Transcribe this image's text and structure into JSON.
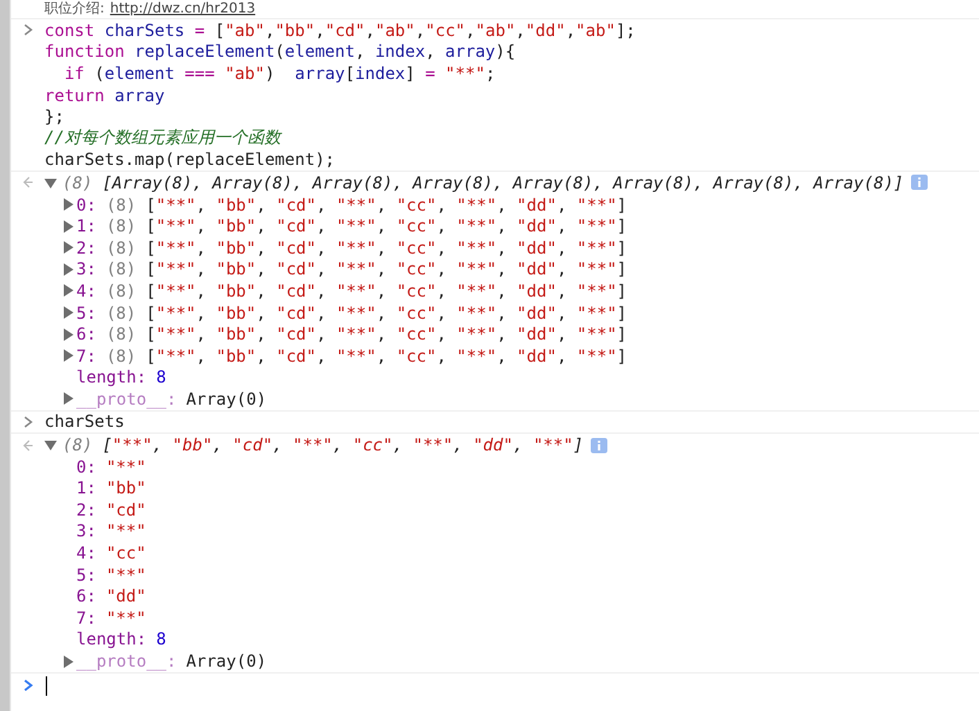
{
  "top_message": {
    "label": "职位介绍:",
    "link": "http://dwz.cn/hr2013"
  },
  "entries": [
    {
      "kind": "input",
      "lines": [
        [
          {
            "kind": "keyword",
            "s": "const"
          },
          {
            "kind": "variable",
            "s": " charSets"
          },
          {
            "kind": "operator",
            "s": " ="
          },
          {
            "kind": "plain",
            "s": " ["
          },
          {
            "kind": "string",
            "s": "\"ab\""
          },
          {
            "kind": "plain",
            "s": ","
          },
          {
            "kind": "string",
            "s": "\"bb\""
          },
          {
            "kind": "plain",
            "s": ","
          },
          {
            "kind": "string",
            "s": "\"cd\""
          },
          {
            "kind": "plain",
            "s": ","
          },
          {
            "kind": "string",
            "s": "\"ab\""
          },
          {
            "kind": "plain",
            "s": ","
          },
          {
            "kind": "string",
            "s": "\"cc\""
          },
          {
            "kind": "plain",
            "s": ","
          },
          {
            "kind": "string",
            "s": "\"ab\""
          },
          {
            "kind": "plain",
            "s": ","
          },
          {
            "kind": "string",
            "s": "\"dd\""
          },
          {
            "kind": "plain",
            "s": ","
          },
          {
            "kind": "string",
            "s": "\"ab\""
          },
          {
            "kind": "plain",
            "s": "];"
          }
        ],
        [
          {
            "kind": "keyword",
            "s": "function"
          },
          {
            "kind": "variable",
            "s": " replaceElement"
          },
          {
            "kind": "plain",
            "s": "("
          },
          {
            "kind": "variable",
            "s": "element"
          },
          {
            "kind": "plain",
            "s": ", "
          },
          {
            "kind": "variable",
            "s": "index"
          },
          {
            "kind": "plain",
            "s": ", "
          },
          {
            "kind": "variable",
            "s": "array"
          },
          {
            "kind": "plain",
            "s": "){"
          }
        ],
        [
          {
            "kind": "keyword",
            "s": "  if"
          },
          {
            "kind": "plain",
            "s": " ("
          },
          {
            "kind": "variable",
            "s": "element"
          },
          {
            "kind": "operator",
            "s": " === "
          },
          {
            "kind": "string",
            "s": "\"ab\""
          },
          {
            "kind": "plain",
            "s": ")  "
          },
          {
            "kind": "variable",
            "s": "array"
          },
          {
            "kind": "plain",
            "s": "["
          },
          {
            "kind": "variable",
            "s": "index"
          },
          {
            "kind": "plain",
            "s": "] "
          },
          {
            "kind": "operator",
            "s": "= "
          },
          {
            "kind": "string",
            "s": "\"**\""
          },
          {
            "kind": "plain",
            "s": ";"
          }
        ],
        [
          {
            "kind": "keyword",
            "s": "return"
          },
          {
            "kind": "variable",
            "s": " array"
          }
        ],
        [
          {
            "kind": "plain",
            "s": "};"
          }
        ],
        [
          {
            "kind": "comment",
            "s": "//对每个数组元素应用一个函数"
          }
        ],
        [
          {
            "kind": "plain",
            "s": "charSets.map(replaceElement);"
          }
        ]
      ]
    },
    {
      "kind": "output",
      "expanded": true,
      "count": "(8)",
      "preview": "[Array(8), Array(8), Array(8), Array(8), Array(8), Array(8), Array(8), Array(8)]",
      "children": [
        {
          "kind": "array",
          "key": "0:",
          "expanded": false,
          "count": "(8)",
          "preview": "[\"**\", \"bb\", \"cd\", \"**\", \"cc\", \"**\", \"dd\", \"**\"]"
        },
        {
          "kind": "array",
          "key": "1:",
          "expanded": false,
          "count": "(8)",
          "preview": "[\"**\", \"bb\", \"cd\", \"**\", \"cc\", \"**\", \"dd\", \"**\"]"
        },
        {
          "kind": "array",
          "key": "2:",
          "expanded": false,
          "count": "(8)",
          "preview": "[\"**\", \"bb\", \"cd\", \"**\", \"cc\", \"**\", \"dd\", \"**\"]"
        },
        {
          "kind": "array",
          "key": "3:",
          "expanded": false,
          "count": "(8)",
          "preview": "[\"**\", \"bb\", \"cd\", \"**\", \"cc\", \"**\", \"dd\", \"**\"]"
        },
        {
          "kind": "array",
          "key": "4:",
          "expanded": false,
          "count": "(8)",
          "preview": "[\"**\", \"bb\", \"cd\", \"**\", \"cc\", \"**\", \"dd\", \"**\"]"
        },
        {
          "kind": "array",
          "key": "5:",
          "expanded": false,
          "count": "(8)",
          "preview": "[\"**\", \"bb\", \"cd\", \"**\", \"cc\", \"**\", \"dd\", \"**\"]"
        },
        {
          "kind": "array",
          "key": "6:",
          "expanded": false,
          "count": "(8)",
          "preview": "[\"**\", \"bb\", \"cd\", \"**\", \"cc\", \"**\", \"dd\", \"**\"]"
        },
        {
          "kind": "array",
          "key": "7:",
          "expanded": false,
          "count": "(8)",
          "preview": "[\"**\", \"bb\", \"cd\", \"**\", \"cc\", \"**\", \"dd\", \"**\"]"
        },
        {
          "kind": "number",
          "key": "length:",
          "value": "8"
        },
        {
          "kind": "proto",
          "key": "__proto__:",
          "value": "Array(0)",
          "expanded": false
        }
      ]
    },
    {
      "kind": "input",
      "lines": [
        [
          {
            "kind": "plain",
            "s": "charSets"
          }
        ]
      ]
    },
    {
      "kind": "output",
      "expanded": true,
      "count": "(8)",
      "preview": "[\"**\", \"bb\", \"cd\", \"**\", \"cc\", \"**\", \"dd\", \"**\"]",
      "children": [
        {
          "kind": "string",
          "key": "0:",
          "value": "\"**\""
        },
        {
          "kind": "string",
          "key": "1:",
          "value": "\"bb\""
        },
        {
          "kind": "string",
          "key": "2:",
          "value": "\"cd\""
        },
        {
          "kind": "string",
          "key": "3:",
          "value": "\"**\""
        },
        {
          "kind": "string",
          "key": "4:",
          "value": "\"cc\""
        },
        {
          "kind": "string",
          "key": "5:",
          "value": "\"**\""
        },
        {
          "kind": "string",
          "key": "6:",
          "value": "\"dd\""
        },
        {
          "kind": "string",
          "key": "7:",
          "value": "\"**\""
        },
        {
          "kind": "number",
          "key": "length:",
          "value": "8"
        },
        {
          "kind": "proto",
          "key": "__proto__:",
          "value": "Array(0)",
          "expanded": false
        }
      ]
    }
  ]
}
